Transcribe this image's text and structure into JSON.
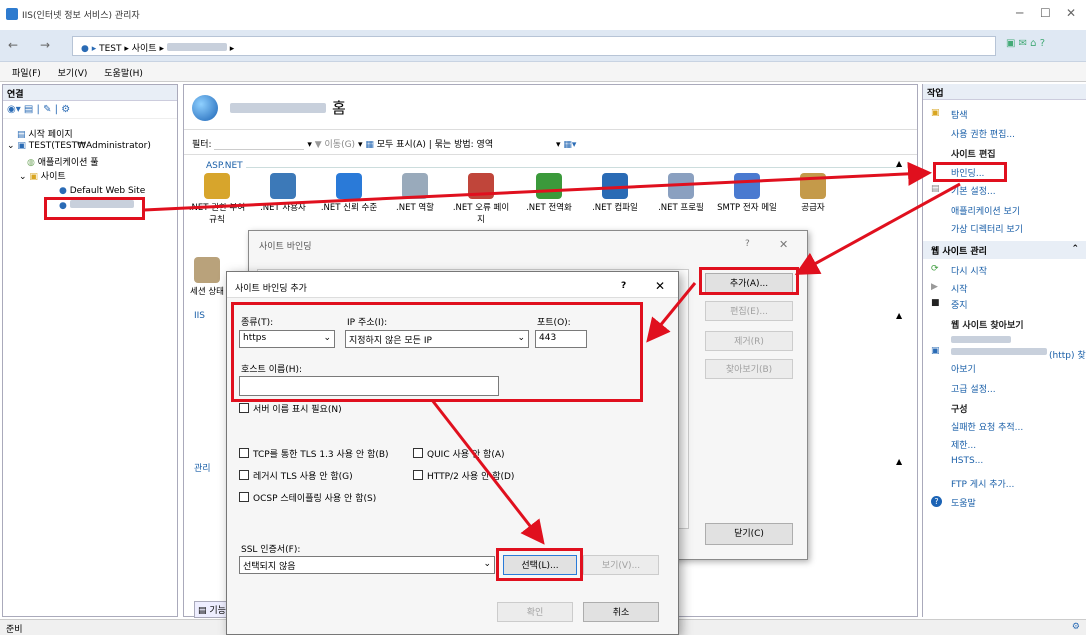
{
  "window": {
    "title": "IIS(인터넷 정보 서비스) 관리자"
  },
  "nav": {
    "crumbs": [
      "TEST",
      "사이트"
    ]
  },
  "menu": [
    "파일(F)",
    "보기(V)",
    "도움말(H)"
  ],
  "left": {
    "header": "연결",
    "tree": [
      "시작 페이지",
      "TEST(TEST₩Administrator)",
      "애플리케이션 풀",
      "사이트",
      "Default Web Site"
    ]
  },
  "center": {
    "title_suffix": "홈",
    "filter_label": "필터:",
    "go_label": "이동(G)",
    "show_all_label": "모두 표시(A)",
    "group_label": "묶는 방법:",
    "group_value": "영역",
    "section_aspnet": "ASP.NET",
    "icons": [
      ".NET 권한 부여 규칙",
      ".NET 사용자",
      ".NET 신뢰 수준",
      ".NET 역할",
      ".NET 오류 페이지",
      ".NET 전역화",
      ".NET 컴파일",
      ".NET 프로필",
      "SMTP 전자 메일",
      "공급자"
    ],
    "session_label": "세션 상태",
    "iis_label": "IIS",
    "manage_label": "관리",
    "bottom_tab": "기능"
  },
  "dlg_binding": {
    "title": "사이트 바인딩",
    "add": "추가(A)...",
    "edit": "편집(E)...",
    "remove": "제거(R)",
    "browse": "찾아보기(B)",
    "close": "닫기(C)"
  },
  "dlg_add": {
    "title": "사이트 바인딩 추가",
    "type_label": "종류(T):",
    "type_value": "https",
    "ip_label": "IP 주소(I):",
    "ip_value": "지정하지 않은 모든 IP",
    "port_label": "포트(O):",
    "port_value": "443",
    "host_label": "호스트 이름(H):",
    "host_value": "",
    "sni": "서버 이름 표시 필요(N)",
    "tls13": "TCP를 통한 TLS 1.3 사용 안 함(B)",
    "quic": "QUIC 사용 안 함(A)",
    "legacy_tls": "레거시 TLS 사용 안 함(G)",
    "http2": "HTTP/2 사용 안 함(D)",
    "ocsp": "OCSP 스테이플링 사용 안 함(S)",
    "ssl_label": "SSL 인증서(F):",
    "ssl_value": "선택되지 않음",
    "select": "선택(L)...",
    "view": "보기(V)...",
    "ok": "확인",
    "cancel": "취소"
  },
  "right": {
    "header": "작업",
    "explore": "탐색",
    "edit_perm": "사용 권한 편집...",
    "site_edit": "사이트 편집",
    "bindings": "바인딩...",
    "basic": "기본 설정...",
    "view_apps": "애플리케이션 보기",
    "view_vdirs": "가상 디렉터리 보기",
    "manage_site": "웹 사이트 관리",
    "restart": "다시 시작",
    "start": "시작",
    "stop": "중지",
    "browse_site": "웹 사이트 찾아보기",
    "browse_http": "(http) 찾",
    "browse_suffix": "아보기",
    "advanced": "고급 설정...",
    "config": "구성",
    "failed_req": "실패한 요청 추적...",
    "limits": "제한...",
    "hsts": "HSTS...",
    "ftp": "FTP 게시 추가...",
    "help": "도움말"
  },
  "status": {
    "text": "준비"
  },
  "colors": {
    "highlight": "#e0101e",
    "link": "#1a5fa8"
  }
}
